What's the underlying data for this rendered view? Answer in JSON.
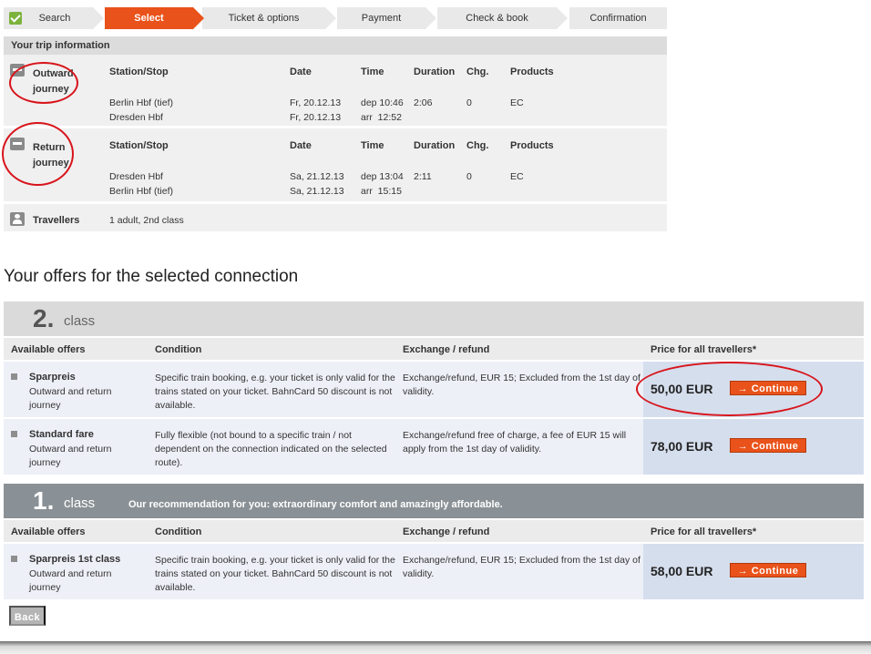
{
  "steps": [
    {
      "label": "Search",
      "state": "done"
    },
    {
      "label": "Select",
      "state": "active"
    },
    {
      "label": "Ticket & options",
      "state": "todo"
    },
    {
      "label": "Payment",
      "state": "todo"
    },
    {
      "label": "Check & book",
      "state": "todo"
    },
    {
      "label": "Confirmation",
      "state": "todo"
    }
  ],
  "trip": {
    "heading": "Your trip information",
    "columns": {
      "station": "Station/Stop",
      "date": "Date",
      "time": "Time",
      "duration": "Duration",
      "changes": "Chg.",
      "products": "Products"
    },
    "outward": {
      "title": "Outward journey",
      "rows": [
        {
          "station": "Berlin Hbf (tief)",
          "date": "Fr, 20.12.13",
          "time": "dep 10:46",
          "duration": "2:06",
          "changes": "0",
          "products": "EC"
        },
        {
          "station": "Dresden Hbf",
          "date": "Fr, 20.12.13",
          "time": "arr  12:52",
          "duration": "",
          "changes": "",
          "products": ""
        }
      ]
    },
    "return": {
      "title": "Return journey",
      "rows": [
        {
          "station": "Dresden Hbf",
          "date": "Sa, 21.12.13",
          "time": "dep 13:04",
          "duration": "2:11",
          "changes": "0",
          "products": "EC"
        },
        {
          "station": "Berlin Hbf (tief)",
          "date": "Sa, 21.12.13",
          "time": "arr  15:15",
          "duration": "",
          "changes": "",
          "products": ""
        }
      ]
    },
    "travellers": {
      "title": "Travellers",
      "value": "1 adult, 2nd class"
    }
  },
  "offers_title": "Your offers for the selected connection",
  "offer_columns": {
    "offers": "Available offers",
    "condition": "Condition",
    "exchange": "Exchange / refund",
    "price": "Price for all travellers*"
  },
  "second_class": {
    "number": "2.",
    "word": "class",
    "offers": [
      {
        "name": "Sparpreis",
        "sub": "Outward and return journey",
        "condition": "Specific train booking, e.g. your ticket is only valid for the trains stated on your ticket. BahnCard 50 discount is not available.",
        "exchange": "Exchange/refund, EUR 15; Excluded from the 1st day of validity.",
        "price": "50,00 EUR",
        "button": "→ Continue"
      },
      {
        "name": "Standard fare",
        "sub": "Outward and return journey",
        "condition": "Fully flexible (not bound to a specific train / not dependent on the connection indicated on the selected route).",
        "exchange": "Exchange/refund free of charge, a fee of EUR 15 will apply from the 1st day of validity.",
        "price": "78,00 EUR",
        "button": "→ Continue"
      }
    ]
  },
  "first_class": {
    "number": "1.",
    "word": "class",
    "recommendation": "Our recommendation for you: extraordinary comfort and amazingly affordable.",
    "offers": [
      {
        "name": "Sparpreis 1st class",
        "sub": "Outward and return journey",
        "condition": "Specific train booking, e.g. your ticket is only valid for the trains stated on your ticket. BahnCard 50 discount is not available.",
        "exchange": "Exchange/refund, EUR 15; Excluded from the 1st day of validity.",
        "price": "58,00 EUR",
        "button": "→ Continue"
      }
    ]
  },
  "back_button": "Back",
  "colors": {
    "accent": "#e9521a",
    "annotation": "#d8141b",
    "check": "#7bb33d"
  }
}
